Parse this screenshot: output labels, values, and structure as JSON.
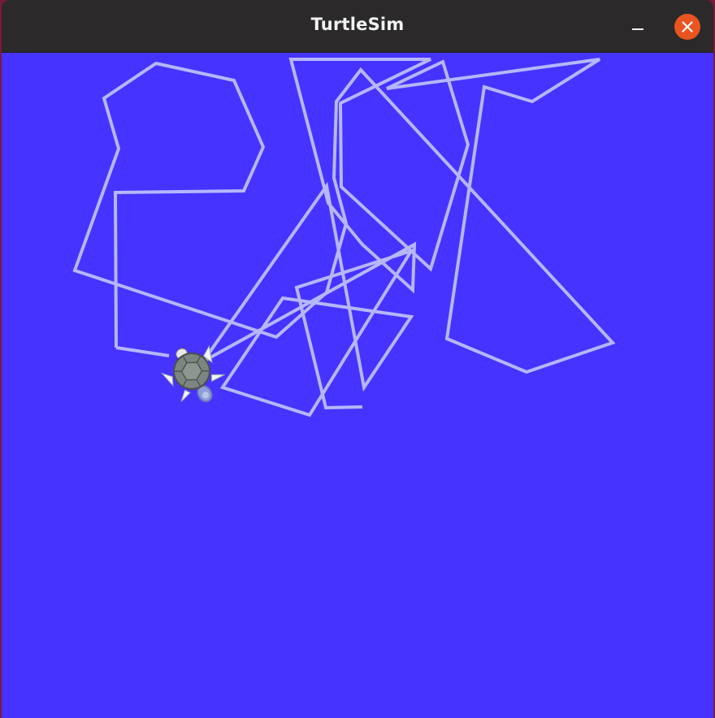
{
  "window": {
    "title": "TurtleSim",
    "background_color": "#4733ff",
    "pen_color": "#b3b8ff",
    "titlebar_color": "#2b2929",
    "close_button_color": "#e95420"
  },
  "controls": {
    "minimize_icon": "minimize-icon",
    "close_icon": "close-icon"
  },
  "turtle": {
    "icon": "turtle-icon"
  }
}
